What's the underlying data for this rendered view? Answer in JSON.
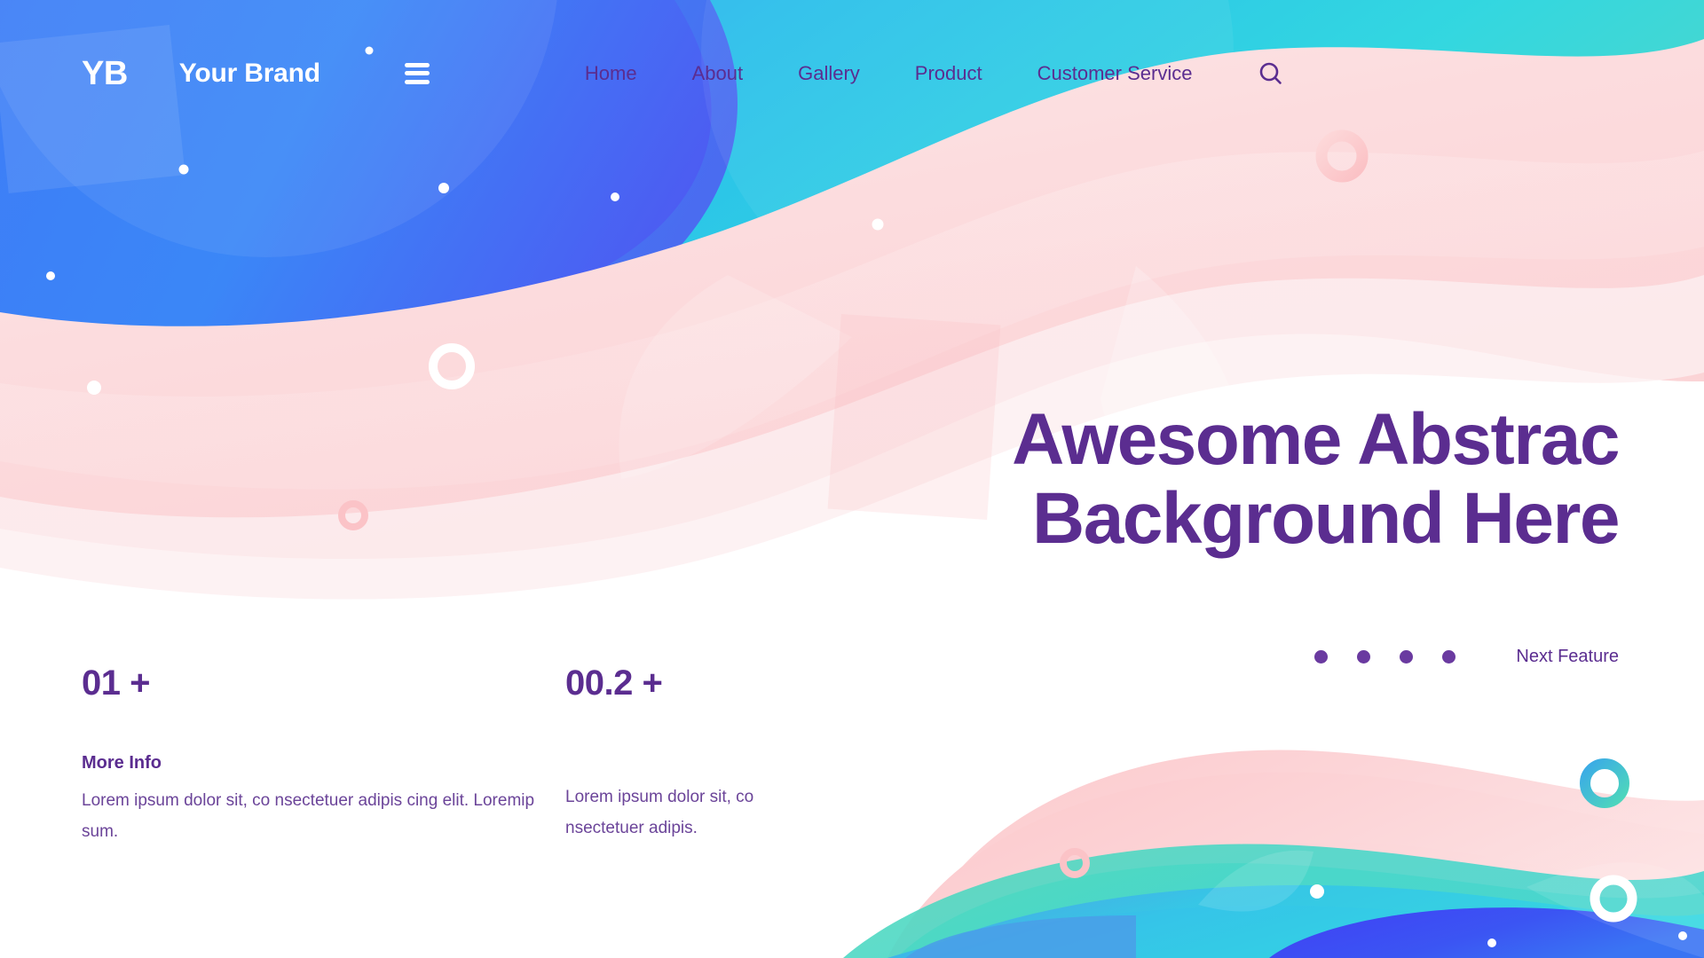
{
  "header": {
    "logo_mark": "YB",
    "brand_name": "Your Brand",
    "menu_icon": "hamburger-icon",
    "search_icon": "search-icon",
    "nav_items": [
      {
        "label": "Home"
      },
      {
        "label": "About"
      },
      {
        "label": "Gallery"
      },
      {
        "label": "Product"
      },
      {
        "label": "Customer Service"
      }
    ]
  },
  "hero": {
    "line1": "Awesome Abstrac",
    "line2": "Background Here"
  },
  "carousel": {
    "dot_count": 4,
    "next_label": "Next Feature"
  },
  "stats": [
    {
      "value": "01 +",
      "heading": "More Info",
      "body": "Lorem ipsum dolor sit, co nsectetuer adipis cing elit. Loremip sum."
    },
    {
      "value": "00.2 +",
      "heading": "",
      "body": "Lorem ipsum dolor sit, co nsectetuer adipis."
    }
  ],
  "colors": {
    "purple_text": "#5b2d90",
    "purple_dot": "#6a3aa0",
    "body_text": "#6b4499",
    "blue_deep": "#3b4ef0",
    "blue": "#3d7ef7",
    "cyan": "#2fd3e8",
    "teal": "#4fd6c0",
    "pink": "#fbd4d6",
    "pink_soft": "#fde7e8",
    "white": "#ffffff"
  }
}
